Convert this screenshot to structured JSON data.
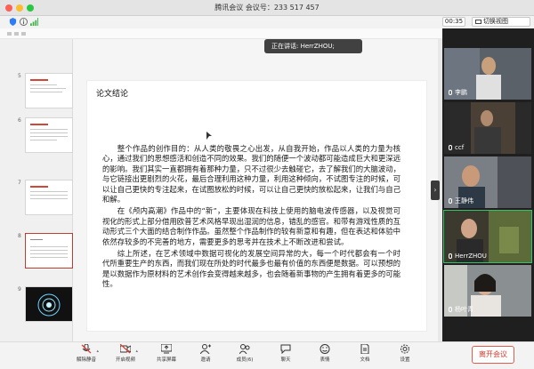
{
  "window": {
    "title": "腾讯会议 会议号：233 517 457"
  },
  "status": {
    "timer": "00:35",
    "view_switch_label": "切换视图"
  },
  "speaking_banner": "正在讲话: HerrZHOU;",
  "slides": {
    "thumb_numbers": [
      "5",
      "6",
      "7",
      "8",
      "9"
    ],
    "selected_index": 3
  },
  "slide": {
    "title": "论文结论",
    "paragraphs": [
      "整个作品的创作目的：从人类的敬畏之心出发，从自我开始，作品以人类的力量为核心，通过我们的思想感活和创造不同的效果。我们的随便一个波动都可能造成巨大和更深远的影响。我们其实一直都拥有着那种力量，只不过很少去触碰它，去了解我们的大脑波动，与它链接出更剧烈的火花，最后合理利用这种力量，利用这种倾向，不试图专注的时候，可以让自己更快的专注起来，在试图放松的时候，可以让自己更快的放松起来，让我们与自己和解。",
      "在《颅内高潮》作品中的“新”，主要体现在科技上使用的脑电波传感器，以及视觉可视化的形式上部分借用欧普艺术风格早现出湿润的信息，错乱的感官。和带有游戏性质的互动形式三个大面的结合制作作品。虽然整个作品制作的较有新意和有趣，但在表达和体验中依然存较多的不完善的地方，需要更多的思考并在技术上不断改进和尝试。",
      "综上所述，在艺术领域中数据可视化的发展空间异常的大，每一个时代都会有一个时代所重要生产的东西，而我们现在所处的时代最多也最有价值的东西便是数据。可以预想的是以数据作为原材料的艺术创作会变得越来越多，也会随着新事物的产生拥有着更多的可能性。"
    ]
  },
  "participants": [
    {
      "name": "李鹏"
    },
    {
      "name": "ccf"
    },
    {
      "name": "王静伟"
    },
    {
      "name": "HerrZHOU"
    },
    {
      "name": "杨叶青"
    }
  ],
  "controls": [
    {
      "label": "解除静音",
      "icon": "mic-off-icon"
    },
    {
      "label": "开启视频",
      "icon": "camera-off-icon"
    },
    {
      "label": "共享屏幕",
      "icon": "share-screen-icon"
    },
    {
      "label": "邀请",
      "icon": "invite-icon"
    },
    {
      "label": "成员(6)",
      "icon": "members-icon"
    },
    {
      "label": "聊天",
      "icon": "chat-icon"
    },
    {
      "label": "表情",
      "icon": "emoji-icon"
    },
    {
      "label": "文档",
      "icon": "document-icon"
    },
    {
      "label": "设置",
      "icon": "settings-icon"
    }
  ],
  "end_button": "离开会议",
  "colors": {
    "end": "#d8382b",
    "active_speaker": "#39c06b",
    "selected_slide": "#c33b2f"
  }
}
